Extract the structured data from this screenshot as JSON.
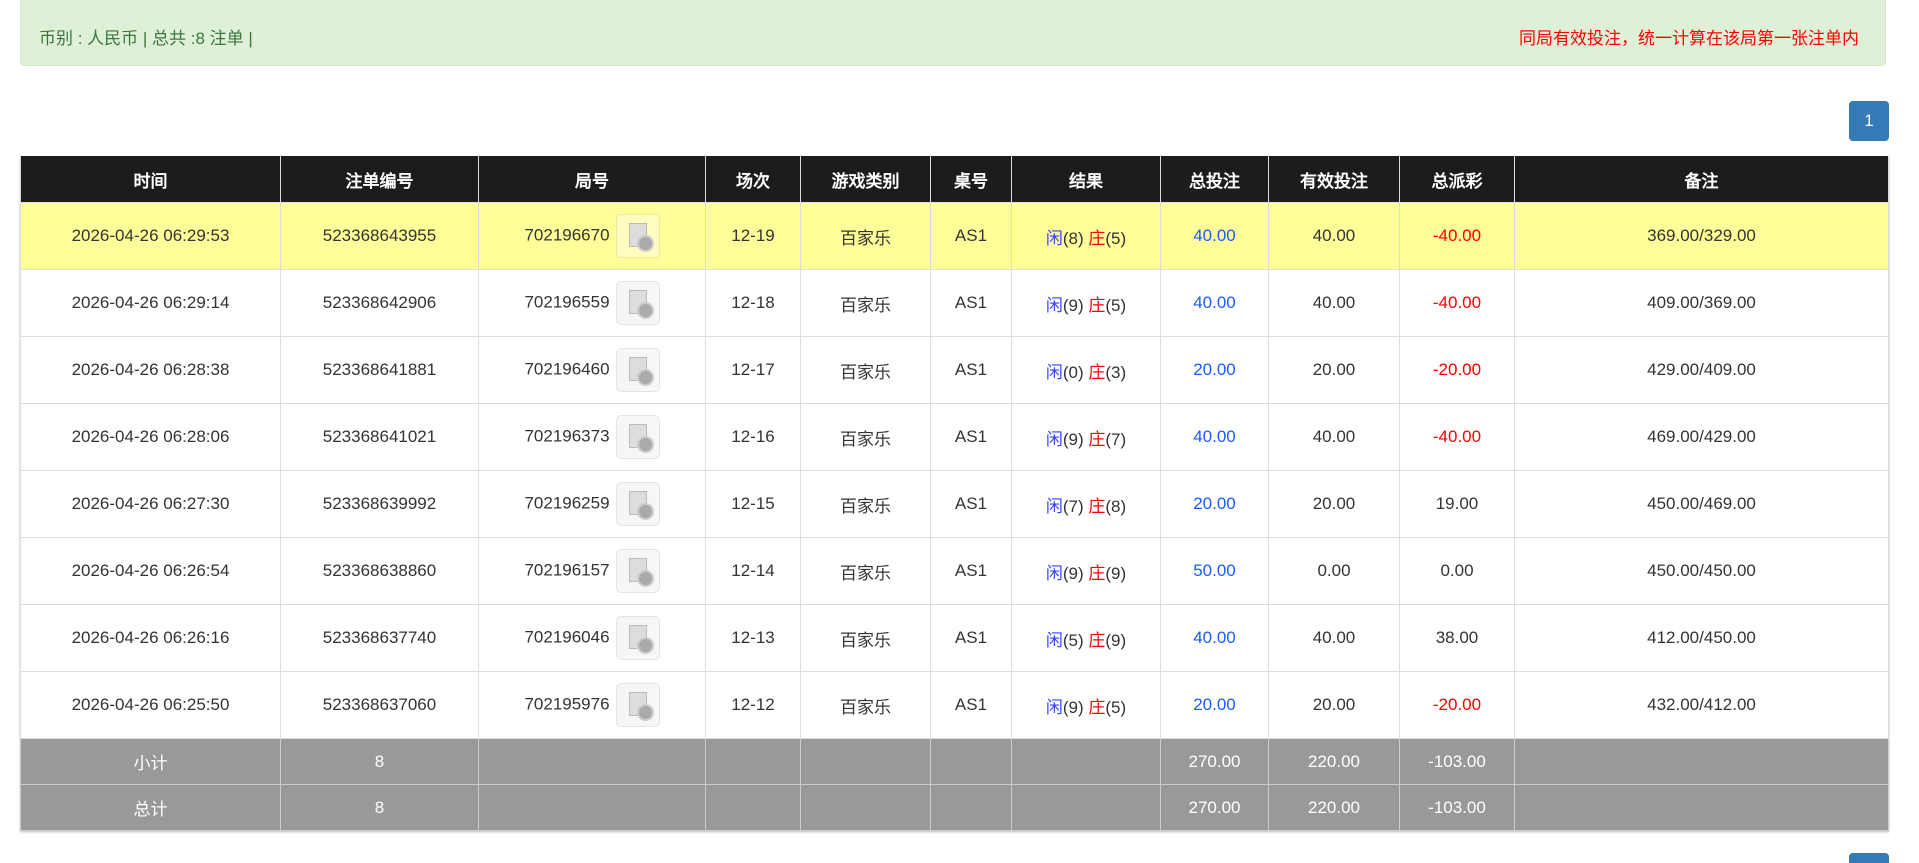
{
  "summary": {
    "left": "币别 : 人民币 | 总共 :8 注单 |",
    "right": "同局有效投注，统一计算在该局第一张注单内"
  },
  "pagination": {
    "current": "1"
  },
  "colors": {
    "header_bg": "#1c1c1c",
    "highlight_row": "#ffff99",
    "summary_row": "#999999",
    "player": "#3344ff",
    "banker": "#ff0000",
    "bet_blue": "#1a5cff",
    "negative": "#ff0000"
  },
  "columns": [
    "时间",
    "注单编号",
    "局号",
    "场次",
    "游戏类别",
    "桌号",
    "结果",
    "总投注",
    "有效投注",
    "总派彩",
    "备注"
  ],
  "rows": [
    {
      "time": "2026-04-26 06:29:53",
      "bet_id": "523368643955",
      "round": "702196670",
      "session": "12-19",
      "game": "百家乐",
      "table": "AS1",
      "p": "闲",
      "pv": "(8)",
      "b": "庄",
      "bv": "(5)",
      "total": "40.00",
      "valid": "40.00",
      "payout": "-40.00",
      "note": "369.00/329.00",
      "neg": true
    },
    {
      "time": "2026-04-26 06:29:14",
      "bet_id": "523368642906",
      "round": "702196559",
      "session": "12-18",
      "game": "百家乐",
      "table": "AS1",
      "p": "闲",
      "pv": "(9)",
      "b": "庄",
      "bv": "(5)",
      "total": "40.00",
      "valid": "40.00",
      "payout": "-40.00",
      "note": "409.00/369.00",
      "neg": true
    },
    {
      "time": "2026-04-26 06:28:38",
      "bet_id": "523368641881",
      "round": "702196460",
      "session": "12-17",
      "game": "百家乐",
      "table": "AS1",
      "p": "闲",
      "pv": "(0)",
      "b": "庄",
      "bv": "(3)",
      "total": "20.00",
      "valid": "20.00",
      "payout": "-20.00",
      "note": "429.00/409.00",
      "neg": true
    },
    {
      "time": "2026-04-26 06:28:06",
      "bet_id": "523368641021",
      "round": "702196373",
      "session": "12-16",
      "game": "百家乐",
      "table": "AS1",
      "p": "闲",
      "pv": "(9)",
      "b": "庄",
      "bv": "(7)",
      "total": "40.00",
      "valid": "40.00",
      "payout": "-40.00",
      "note": "469.00/429.00",
      "neg": true
    },
    {
      "time": "2026-04-26 06:27:30",
      "bet_id": "523368639992",
      "round": "702196259",
      "session": "12-15",
      "game": "百家乐",
      "table": "AS1",
      "p": "闲",
      "pv": "(7)",
      "b": "庄",
      "bv": "(8)",
      "total": "20.00",
      "valid": "20.00",
      "payout": "19.00",
      "note": "450.00/469.00",
      "neg": false
    },
    {
      "time": "2026-04-26 06:26:54",
      "bet_id": "523368638860",
      "round": "702196157",
      "session": "12-14",
      "game": "百家乐",
      "table": "AS1",
      "p": "闲",
      "pv": "(9)",
      "b": "庄",
      "bv": "(9)",
      "total": "50.00",
      "valid": "0.00",
      "payout": "0.00",
      "note": "450.00/450.00",
      "neg": false
    },
    {
      "time": "2026-04-26 06:26:16",
      "bet_id": "523368637740",
      "round": "702196046",
      "session": "12-13",
      "game": "百家乐",
      "table": "AS1",
      "p": "闲",
      "pv": "(5)",
      "b": "庄",
      "bv": "(9)",
      "total": "40.00",
      "valid": "40.00",
      "payout": "38.00",
      "note": "412.00/450.00",
      "neg": false
    },
    {
      "time": "2026-04-26 06:25:50",
      "bet_id": "523368637060",
      "round": "702195976",
      "session": "12-12",
      "game": "百家乐",
      "table": "AS1",
      "p": "闲",
      "pv": "(9)",
      "b": "庄",
      "bv": "(5)",
      "total": "20.00",
      "valid": "20.00",
      "payout": "-20.00",
      "note": "432.00/412.00",
      "neg": true
    }
  ],
  "subtotal": {
    "label": "小计",
    "count": "8",
    "total": "270.00",
    "valid": "220.00",
    "payout": "-103.00"
  },
  "grandtotal": {
    "label": "总计",
    "count": "8",
    "total": "270.00",
    "valid": "220.00",
    "payout": "-103.00"
  }
}
